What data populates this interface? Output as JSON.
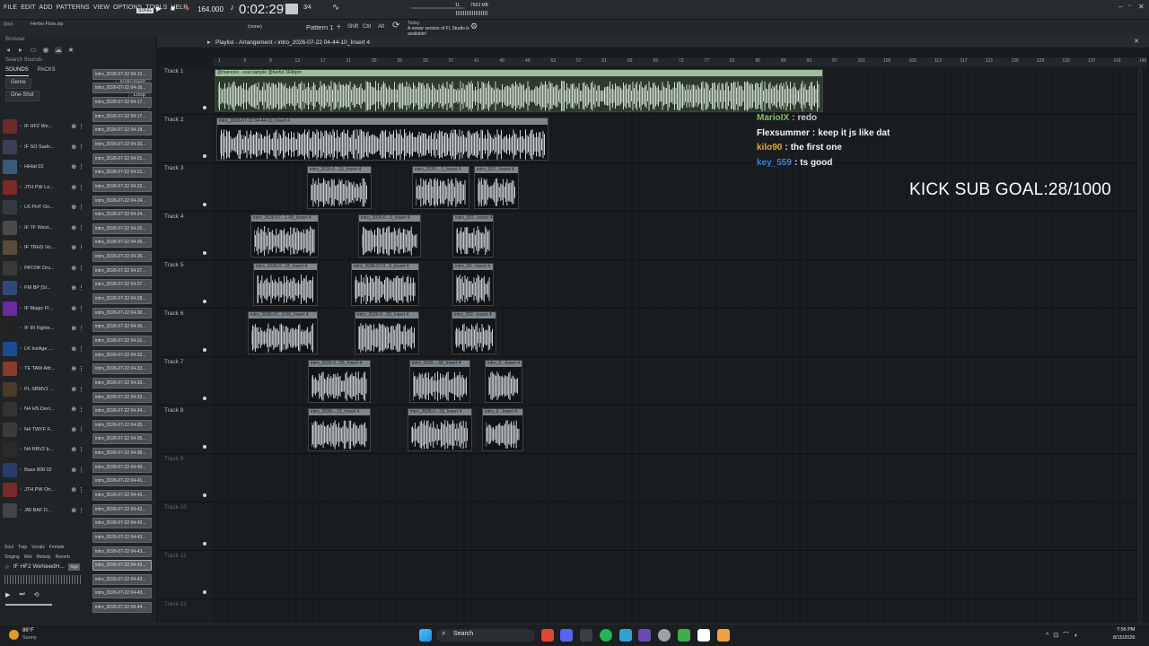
{
  "app": {
    "menu": [
      "FILE",
      "EDIT",
      "ADD",
      "PATTERNS",
      "VIEW",
      "OPTIONS",
      "TOOLS",
      "HELP"
    ],
    "song_mode": "SONG",
    "tempo": "164.000",
    "time": "0:02:29",
    "time_suffix": "M:S:CS",
    "pattern": "Pattern 1",
    "snap": "(none)",
    "keys": [
      "Shift",
      "Ctrl",
      "Alt"
    ],
    "memory": "7663 MB",
    "cpu": "11",
    "hint": "Herbo Flow.zip",
    "user": "(jay)",
    "news_date": "Today",
    "news_text": "A newer version of FL Studio is available!",
    "accent": "#9fc09b"
  },
  "browser": {
    "title": "Browser",
    "search": "Search Sounds",
    "tabs": [
      "SOUNDS",
      "PACKS"
    ],
    "filters": [
      "Genre",
      "Instrument"
    ],
    "types": [
      "One-Shot",
      "Loop"
    ],
    "sort": "Trending",
    "samples": [
      "IF HF2 We...",
      "IF SO Sadn...",
      "HiHat 02",
      "JTH PW Lo...",
      "LK PHT On...",
      "IF TF West...",
      "IF TRHS Vo...",
      "PATZIK Dru...",
      "FM BP [SI...",
      "IF Magic Fl...",
      "IF IR Fighte...",
      "LK IceAge ...",
      "TE TAW Attr...",
      "PL SBMV1 ...",
      "N4 HS Devi...",
      "N4 TWYF F...",
      "N4 RBV2 b...",
      "Bass 808 02",
      "JTH PW On...",
      "JW BAF D..."
    ],
    "files": [
      "intro_2026-07-22 04-12...",
      "intro_2026-07-22 04-16...",
      "intro_2026-07-22 04-17...",
      "intro_2026-07-22 04-17...",
      "intro_2026-07-22 04-18...",
      "intro_2026-07-22 04-20...",
      "intro_2026-07-22 04-21...",
      "intro_2026-07-22 04-21...",
      "intro_2026-07-22 04-22...",
      "intro_2026-07-22 04-24...",
      "intro_2026-07-22 04-24...",
      "intro_2026-07-22 04-25...",
      "intro_2026-07-22 04-26...",
      "intro_2026-07-22 04-26...",
      "intro_2026-07-22 04-27...",
      "intro_2026-07-22 04-27...",
      "intro_2026-07-22 04-28...",
      "intro_2026-07-22 04-30...",
      "intro_2026-07-22 04-30...",
      "intro_2026-07-22 04-31...",
      "intro_2026-07-22 04-32...",
      "intro_2026-07-22 04-33...",
      "intro_2026-07-22 04-33...",
      "intro_2026-07-22 04-33...",
      "intro_2026-07-22 04-34...",
      "intro_2026-07-22 04-35...",
      "intro_2026-07-22 04-35...",
      "intro_2026-07-22 04-38...",
      "intro_2026-07-22 04-40...",
      "intro_2026-07-22 04-41...",
      "intro_2026-07-22 04-42...",
      "intro_2026-07-22 04-42...",
      "intro_2026-07-22 04-42...",
      "intro_2026-07-22 04-43...",
      "intro_2026-07-22 04-43...",
      "intro_2026-07-22 04-43...",
      "intro_2026-07-22 04-43...",
      "intro_2026-07-22 04-43...",
      "intro_2026-07-22 04-44..."
    ],
    "tags1": [
      "Soul",
      "Trap",
      "Vocals",
      "Female"
    ],
    "tags2": [
      "Singing",
      "Wet",
      "Melody",
      "Reverb"
    ],
    "preview": "IF HF2 WeNeedH...",
    "preview_tag": "Tags"
  },
  "playlist": {
    "title": "Playlist - Arrangement",
    "arrangement": "intro_2026-07-22 04-44-10_Insert 4",
    "tracks": [
      "Track 1",
      "Track 2",
      "Track 3",
      "Track 4",
      "Track 5",
      "Track 6",
      "Track 7",
      "Track 8",
      "Track 9",
      "Track 10",
      "Track 11",
      "Track 12"
    ],
    "ruler": [
      "1",
      "5",
      "9",
      "13",
      "17",
      "21",
      "25",
      "29",
      "33",
      "37",
      "41",
      "45",
      "49",
      "53",
      "57",
      "61",
      "65",
      "69",
      "73",
      "77",
      "81",
      "85",
      "89",
      "93",
      "97",
      "101",
      "105",
      "109",
      "113",
      "117",
      "121",
      "125",
      "129",
      "133",
      "137",
      "141",
      "145"
    ],
    "clip1": "@marvoxx - soul sample @herbo 164bpm",
    "clip2": "intro_2026-07-22 04-44-10_Insert 4",
    "lanes": [
      [
        "intro_2026-0...33_Insert 4",
        "intro_2026-...1_Insert 4",
        "intro_202...Insert 4"
      ],
      [
        "intro_2026-07...1-08_Insert 4",
        "intro_2026-0...0_Insert 4",
        "intro_202...Insert 4"
      ],
      [
        "intro_2026-0...33_Insert 4",
        "intro_2026-07-0...0_Insert 4",
        "intro_20...Insert 4"
      ],
      [
        "intro_2026-07...3-50_Insert 4",
        "intro_2026-0...29_Insert 4",
        "intro_202...Insert 4"
      ],
      [
        "intro_2026-0...55_Insert 4",
        "intro_2026-...56_Insert 4",
        "intro_2...Insert 4"
      ],
      [
        "intro_2026-...11_Insert 4",
        "intro_2026-0...29_Insert 4",
        "intro_2...Insert 4"
      ]
    ]
  },
  "overlay": {
    "chat": [
      {
        "user": "MarioIX",
        "text": "redo",
        "ucolor": "#7fbf5f",
        "tcolor": "#c9c9c9"
      },
      {
        "user": "Flexsummer",
        "text": "keep it js like dat",
        "ucolor": "#f2f2f2",
        "tcolor": "#f2f2f2"
      },
      {
        "user": "kilo90",
        "text": "the first one",
        "ucolor": "#e8a53a",
        "tcolor": "#f2f2f2"
      },
      {
        "user": "key_559",
        "text": "ts good",
        "ucolor": "#3b82d6",
        "tcolor": "#f2f2f2"
      }
    ],
    "goal": "KICK SUB GOAL:28/1000"
  },
  "taskbar": {
    "temp": "86°F",
    "weather": "Sunny",
    "search": "Search",
    "time": "7:56 PM",
    "date": "8/15/2026"
  }
}
